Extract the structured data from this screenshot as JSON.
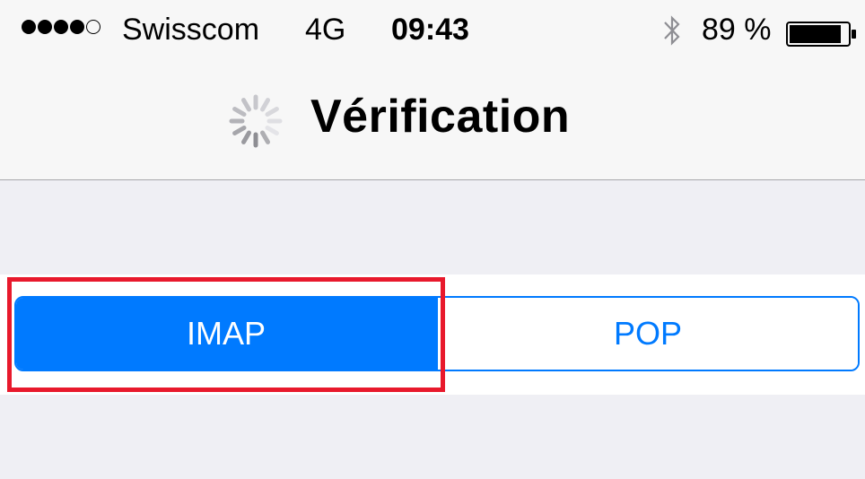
{
  "status_bar": {
    "signal_icon": "signal-dots-icon",
    "signal_filled": 4,
    "signal_total": 5,
    "carrier": "Swisscom",
    "network": "4G",
    "time": "09:43",
    "bluetooth_icon": "bluetooth-icon",
    "battery_percent": "89 %",
    "battery_icon": "battery-icon",
    "battery_level": 0.89
  },
  "nav_bar": {
    "spinner_icon": "activity-spinner-icon",
    "title": "Vérification"
  },
  "segmented_control": {
    "options": [
      {
        "label": "IMAP",
        "selected": true
      },
      {
        "label": "POP",
        "selected": false
      }
    ]
  },
  "colors": {
    "accent": "#007aff",
    "highlight": "#e8192c",
    "background": "#efeff4",
    "header_background": "#f7f7f7"
  }
}
